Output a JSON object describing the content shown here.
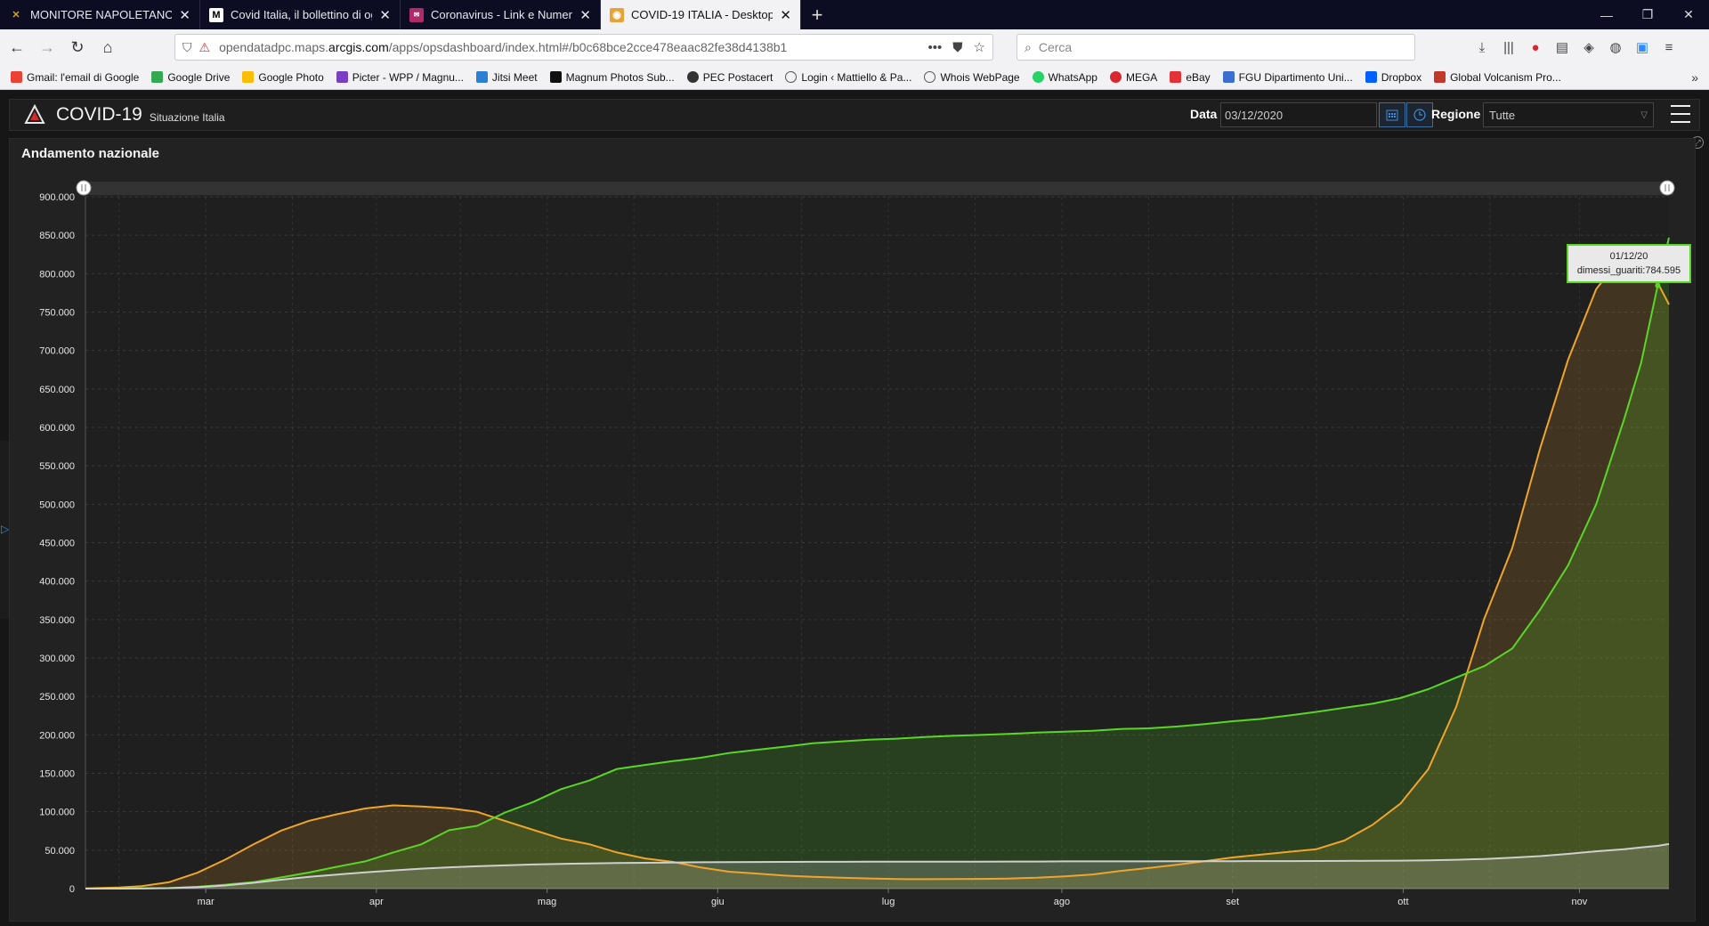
{
  "tabs": [
    {
      "title": "MONITORE NAPOLETANO - Ar",
      "icon": "monitore-favicon",
      "color": "#d4a017"
    },
    {
      "title": "Covid Italia, il bollettino di ogg",
      "icon": "m-favicon",
      "color": "#ffffff"
    },
    {
      "title": "Coronavirus - Link e Numeri de",
      "icon": "coronavirus-favicon",
      "color": "#b02a6a"
    },
    {
      "title": "COVID-19 ITALIA - Desktop",
      "icon": "arcgis-favicon",
      "color": "#e8a23a"
    }
  ],
  "url": {
    "prefix": "opendatadpc.maps.",
    "domain": "arcgis.com",
    "path": "/apps/opsdashboard/index.html#/b0c68bce2cce478eaac82fe38d4138b1"
  },
  "search_placeholder": "Cerca",
  "bookmarks": [
    {
      "label": "Gmail: l'email di Google",
      "color": "#ea4335"
    },
    {
      "label": "Google Drive",
      "color": "#34a853"
    },
    {
      "label": "Google Photo",
      "color": "#fbbc05"
    },
    {
      "label": "Picter - WPP / Magnu...",
      "color": "#7b3fc4"
    },
    {
      "label": "Jitsi Meet",
      "color": "#2d7fd3"
    },
    {
      "label": "Magnum Photos Sub...",
      "color": "#111111"
    },
    {
      "label": "PEC Postacert",
      "color": "#333333"
    },
    {
      "label": "Login ‹ Mattiello & Pa...",
      "color": "#555555"
    },
    {
      "label": "Whois WebPage",
      "color": "#555555"
    },
    {
      "label": "WhatsApp",
      "color": "#25d366"
    },
    {
      "label": "MEGA",
      "color": "#d9272e"
    },
    {
      "label": "eBay",
      "color": "#e53238"
    },
    {
      "label": "FGU Dipartimento Uni...",
      "color": "#3b6ed1"
    },
    {
      "label": "Dropbox",
      "color": "#0061ff"
    },
    {
      "label": "Global Volcanism Pro...",
      "color": "#c0392b"
    }
  ],
  "app": {
    "title": "COVID-19",
    "subtitle": "Situazione Italia",
    "date_label": "Data",
    "date_value": "03/12/2020",
    "region_label": "Regione",
    "region_value": "Tutte"
  },
  "widget_title": "Andamento nazionale",
  "tooltip": {
    "date": "01/12/20",
    "text": "dimessi_guariti:784.595"
  },
  "colors": {
    "orange": "#f0a52a",
    "green": "#5ad626",
    "white": "#cfcfcf"
  },
  "chart_data": {
    "type": "area",
    "x_start": "2020-02-24",
    "ylim": [
      0,
      900000
    ],
    "yticks": [
      0,
      50000,
      100000,
      150000,
      200000,
      250000,
      300000,
      350000,
      400000,
      450000,
      500000,
      550000,
      600000,
      650000,
      700000,
      750000,
      800000,
      850000,
      900000
    ],
    "ytick_labels": [
      "0",
      "50.000",
      "100.000",
      "150.000",
      "200.000",
      "250.000",
      "300.000",
      "350.000",
      "400.000",
      "450.000",
      "500.000",
      "550.000",
      "600.000",
      "650.000",
      "700.000",
      "750.000",
      "800.000",
      "850.000",
      "900.000"
    ],
    "xticks": [
      {
        "date": "2020-03-01",
        "label": "mar"
      },
      {
        "date": "2020-04-01",
        "label": "apr"
      },
      {
        "date": "2020-05-01",
        "label": "mag"
      },
      {
        "date": "2020-06-01",
        "label": "giu"
      },
      {
        "date": "2020-07-01",
        "label": "lug"
      },
      {
        "date": "2020-08-01",
        "label": "ago"
      },
      {
        "date": "2020-09-01",
        "label": "set"
      },
      {
        "date": "2020-10-01",
        "label": "ott"
      },
      {
        "date": "2020-11-01",
        "label": "nov"
      }
    ],
    "x_end": "2020-12-03",
    "series": [
      {
        "color": "#f0a52a",
        "points": [
          [
            "2020-02-24",
            200
          ],
          [
            "2020-03-01",
            1500
          ],
          [
            "2020-03-05",
            3100
          ],
          [
            "2020-03-10",
            8500
          ],
          [
            "2020-03-15",
            20600
          ],
          [
            "2020-03-20",
            37800
          ],
          [
            "2020-03-25",
            57500
          ],
          [
            "2020-03-30",
            75500
          ],
          [
            "2020-04-04",
            88300
          ],
          [
            "2020-04-09",
            96800
          ],
          [
            "2020-04-14",
            104300
          ],
          [
            "2020-04-19",
            108300
          ],
          [
            "2020-04-24",
            106900
          ],
          [
            "2020-04-29",
            104600
          ],
          [
            "2020-05-04",
            99800
          ],
          [
            "2020-05-09",
            87900
          ],
          [
            "2020-05-14",
            76400
          ],
          [
            "2020-05-19",
            65100
          ],
          [
            "2020-05-24",
            57800
          ],
          [
            "2020-05-29",
            47000
          ],
          [
            "2020-06-03",
            39300
          ],
          [
            "2020-06-08",
            34700
          ],
          [
            "2020-06-13",
            27500
          ],
          [
            "2020-06-18",
            22000
          ],
          [
            "2020-06-23",
            19600
          ],
          [
            "2020-06-28",
            16900
          ],
          [
            "2020-07-03",
            15300
          ],
          [
            "2020-07-08",
            14200
          ],
          [
            "2020-07-13",
            13200
          ],
          [
            "2020-07-18",
            12400
          ],
          [
            "2020-07-23",
            12300
          ],
          [
            "2020-07-28",
            12400
          ],
          [
            "2020-08-02",
            12600
          ],
          [
            "2020-08-07",
            13100
          ],
          [
            "2020-08-12",
            14100
          ],
          [
            "2020-08-17",
            16000
          ],
          [
            "2020-08-22",
            18400
          ],
          [
            "2020-08-27",
            23000
          ],
          [
            "2020-09-01",
            26800
          ],
          [
            "2020-09-06",
            31000
          ],
          [
            "2020-09-11",
            35600
          ],
          [
            "2020-09-16",
            40500
          ],
          [
            "2020-09-21",
            44100
          ],
          [
            "2020-09-26",
            47800
          ],
          [
            "2020-10-01",
            51300
          ],
          [
            "2020-10-06",
            62600
          ],
          [
            "2020-10-11",
            82800
          ],
          [
            "2020-10-16",
            110500
          ],
          [
            "2020-10-21",
            155600
          ],
          [
            "2020-10-26",
            236700
          ],
          [
            "2020-10-31",
            351400
          ],
          [
            "2020-11-05",
            443200
          ],
          [
            "2020-11-10",
            573300
          ],
          [
            "2020-11-15",
            688400
          ],
          [
            "2020-11-20",
            780000
          ],
          [
            "2020-11-22",
            798300
          ],
          [
            "2020-11-25",
            796300
          ],
          [
            "2020-11-28",
            794300
          ],
          [
            "2020-12-01",
            788000
          ],
          [
            "2020-12-03",
            760000
          ]
        ]
      },
      {
        "color": "#5ad626",
        "points": [
          [
            "2020-02-24",
            0
          ],
          [
            "2020-03-01",
            83
          ],
          [
            "2020-03-05",
            414
          ],
          [
            "2020-03-10",
            724
          ],
          [
            "2020-03-15",
            2335
          ],
          [
            "2020-03-20",
            5129
          ],
          [
            "2020-03-25",
            8326
          ],
          [
            "2020-03-30",
            14620
          ],
          [
            "2020-04-04",
            20996
          ],
          [
            "2020-04-09",
            28470
          ],
          [
            "2020-04-14",
            35435
          ],
          [
            "2020-04-19",
            47055
          ],
          [
            "2020-04-24",
            57576
          ],
          [
            "2020-04-29",
            75945
          ],
          [
            "2020-05-04",
            81654
          ],
          [
            "2020-05-09",
            99023
          ],
          [
            "2020-05-14",
            112541
          ],
          [
            "2020-05-19",
            129401
          ],
          [
            "2020-05-24",
            140479
          ],
          [
            "2020-05-29",
            155633
          ],
          [
            "2020-06-03",
            160938
          ],
          [
            "2020-06-08",
            165837
          ],
          [
            "2020-06-13",
            170250
          ],
          [
            "2020-06-18",
            176370
          ],
          [
            "2020-06-23",
            180544
          ],
          [
            "2020-06-28",
            184585
          ],
          [
            "2020-07-03",
            189196
          ],
          [
            "2020-07-08",
            191467
          ],
          [
            "2020-07-13",
            193640
          ],
          [
            "2020-07-18",
            195106
          ],
          [
            "2020-07-23",
            197162
          ],
          [
            "2020-07-28",
            198756
          ],
          [
            "2020-08-02",
            199974
          ],
          [
            "2020-08-07",
            201211
          ],
          [
            "2020-08-12",
            202923
          ],
          [
            "2020-08-17",
            204142
          ],
          [
            "2020-08-22",
            205203
          ],
          [
            "2020-08-27",
            207653
          ],
          [
            "2020-09-01",
            208490
          ],
          [
            "2020-09-06",
            210801
          ],
          [
            "2020-09-11",
            213950
          ],
          [
            "2020-09-16",
            217716
          ],
          [
            "2020-09-21",
            220665
          ],
          [
            "2020-09-26",
            225190
          ],
          [
            "2020-10-01",
            229970
          ],
          [
            "2020-10-06",
            235303
          ],
          [
            "2020-10-11",
            240445
          ],
          [
            "2020-10-16",
            247872
          ],
          [
            "2020-10-21",
            259456
          ],
          [
            "2020-10-26",
            274644
          ],
          [
            "2020-10-31",
            289426
          ],
          [
            "2020-11-05",
            312339
          ],
          [
            "2020-11-10",
            363023
          ],
          [
            "2020-11-15",
            420810
          ],
          [
            "2020-11-20",
            499986
          ],
          [
            "2020-11-25",
            610745
          ],
          [
            "2020-11-28",
            683294
          ],
          [
            "2020-12-01",
            784595
          ],
          [
            "2020-12-03",
            846809
          ]
        ]
      },
      {
        "color": "#cfcfcf",
        "points": [
          [
            "2020-02-24",
            7
          ],
          [
            "2020-03-01",
            34
          ],
          [
            "2020-03-05",
            148
          ],
          [
            "2020-03-10",
            631
          ],
          [
            "2020-03-15",
            1809
          ],
          [
            "2020-03-20",
            4032
          ],
          [
            "2020-03-25",
            7503
          ],
          [
            "2020-03-30",
            11591
          ],
          [
            "2020-04-04",
            15362
          ],
          [
            "2020-04-09",
            18279
          ],
          [
            "2020-04-14",
            21067
          ],
          [
            "2020-04-19",
            23660
          ],
          [
            "2020-04-24",
            25969
          ],
          [
            "2020-04-29",
            27682
          ],
          [
            "2020-05-04",
            29079
          ],
          [
            "2020-05-09",
            30201
          ],
          [
            "2020-05-14",
            31368
          ],
          [
            "2020-05-19",
            32169
          ],
          [
            "2020-05-24",
            32735
          ],
          [
            "2020-05-29",
            33229
          ],
          [
            "2020-06-03",
            33601
          ],
          [
            "2020-06-08",
            33899
          ],
          [
            "2020-06-13",
            34301
          ],
          [
            "2020-06-18",
            34514
          ],
          [
            "2020-06-23",
            34675
          ],
          [
            "2020-06-28",
            34738
          ],
          [
            "2020-07-03",
            34833
          ],
          [
            "2020-07-08",
            34914
          ],
          [
            "2020-07-13",
            34967
          ],
          [
            "2020-07-18",
            35028
          ],
          [
            "2020-07-23",
            35092
          ],
          [
            "2020-07-28",
            35123
          ],
          [
            "2020-08-02",
            35154
          ],
          [
            "2020-08-07",
            35190
          ],
          [
            "2020-08-12",
            35225
          ],
          [
            "2020-08-17",
            35400
          ],
          [
            "2020-08-22",
            35418
          ],
          [
            "2020-08-27",
            35463
          ],
          [
            "2020-09-01",
            35491
          ],
          [
            "2020-09-06",
            35553
          ],
          [
            "2020-09-11",
            35603
          ],
          [
            "2020-09-16",
            35645
          ],
          [
            "2020-09-21",
            35738
          ],
          [
            "2020-09-26",
            35818
          ],
          [
            "2020-10-01",
            35918
          ],
          [
            "2020-10-06",
            36030
          ],
          [
            "2020-10-11",
            36205
          ],
          [
            "2020-10-16",
            36427
          ],
          [
            "2020-10-21",
            36832
          ],
          [
            "2020-10-26",
            37479
          ],
          [
            "2020-10-31",
            38618
          ],
          [
            "2020-11-05",
            40192
          ],
          [
            "2020-11-10",
            42330
          ],
          [
            "2020-11-15",
            45229
          ],
          [
            "2020-11-20",
            48569
          ],
          [
            "2020-11-25",
            51306
          ],
          [
            "2020-11-28",
            53677
          ],
          [
            "2020-12-01",
            55576
          ],
          [
            "2020-12-03",
            58038
          ]
        ]
      }
    ],
    "grid": true,
    "legend": "none"
  }
}
